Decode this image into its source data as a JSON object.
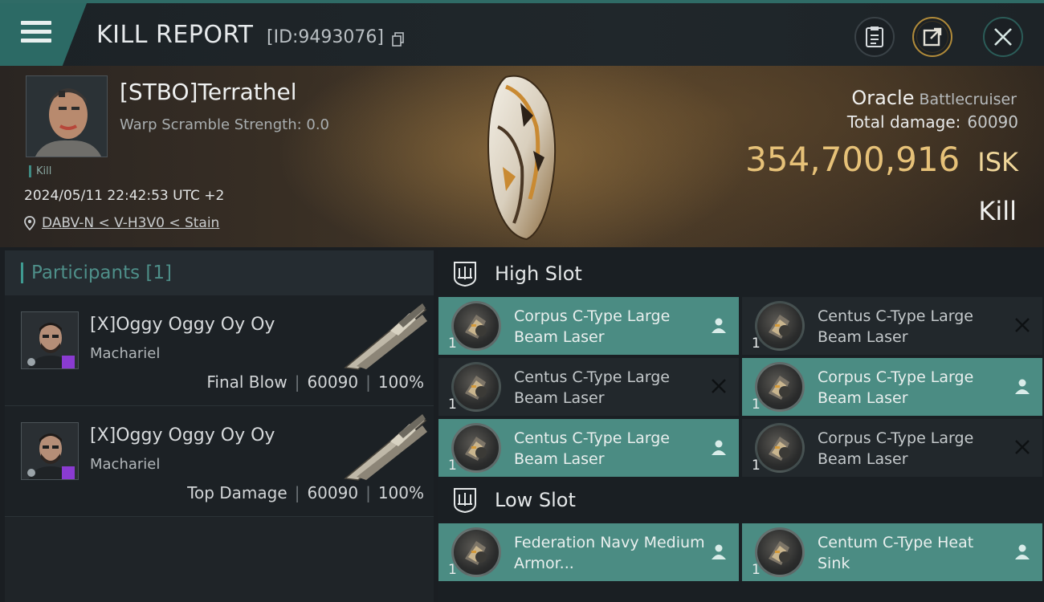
{
  "header": {
    "title": "KILL REPORT",
    "report_id": "[ID:9493076]"
  },
  "victim": {
    "name": "[STBO]Terrathel",
    "warp_scramble": "Warp Scramble Strength: 0.0",
    "tag": "Kill",
    "datetime": "2024/05/11 22:42:53 UTC +2",
    "location": "DABV-N < V-H3V0 < Stain",
    "ship_name": "Oracle",
    "ship_class": "Battlecruiser",
    "total_damage_label": "Total damage:",
    "total_damage": "60090",
    "isk_value": "354,700,916",
    "isk_unit": "ISK",
    "result": "Kill"
  },
  "participants": {
    "title": "Participants",
    "count": "[1]",
    "list": [
      {
        "name": "[X]Oggy Oggy Oy Oy",
        "ship": "Machariel",
        "role": "Final Blow",
        "damage": "60090",
        "percent": "100%"
      },
      {
        "name": "[X]Oggy Oggy Oy Oy",
        "ship": "Machariel",
        "role": "Top Damage",
        "damage": "60090",
        "percent": "100%"
      }
    ]
  },
  "fitting": {
    "high_slot": {
      "title": "High Slot",
      "modules": [
        {
          "name": "Corpus C-Type Large Beam Laser",
          "qty": "1",
          "status": "fitted"
        },
        {
          "name": "Centus C-Type Large Beam Laser",
          "qty": "1",
          "status": "destroyed"
        },
        {
          "name": "Centus C-Type Large Beam Laser",
          "qty": "1",
          "status": "destroyed"
        },
        {
          "name": "Corpus C-Type Large Beam Laser",
          "qty": "1",
          "status": "fitted"
        },
        {
          "name": "Centus C-Type Large Beam Laser",
          "qty": "1",
          "status": "fitted"
        },
        {
          "name": "Corpus C-Type Large Beam Laser",
          "qty": "1",
          "status": "destroyed"
        }
      ]
    },
    "low_slot": {
      "title": "Low Slot",
      "modules": [
        {
          "name": "Federation Navy Medium Armor...",
          "qty": "1",
          "status": "fitted"
        },
        {
          "name": "Centum C-Type Heat Sink",
          "qty": "1",
          "status": "fitted"
        }
      ]
    }
  },
  "colors": {
    "accent": "#2c6a65",
    "fitted": "#4b8c83",
    "isk": "#e6c178"
  },
  "icons": [
    "menu-icon",
    "copy-icon",
    "clipboard-icon",
    "export-icon",
    "close-icon",
    "location-pin-icon",
    "slot-icon",
    "pilot-icon",
    "destroyed-x-icon"
  ]
}
